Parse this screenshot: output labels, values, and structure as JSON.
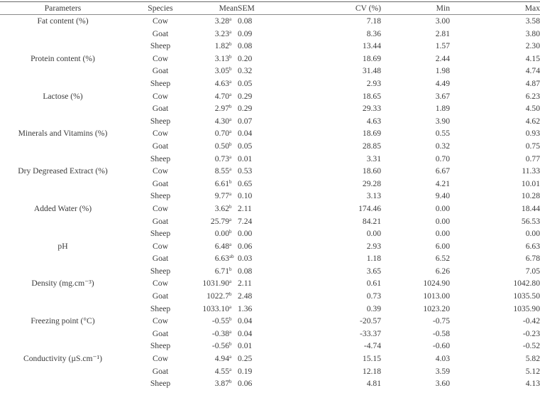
{
  "table": {
    "headers": [
      "Parameters",
      "Species",
      "Mean",
      "SEM",
      "CV (%)",
      "Min",
      "Max"
    ],
    "rows": [
      {
        "parameter": "Fat content (%)",
        "species": "Cow",
        "mean": "3.28",
        "sig": "a",
        "sem": "0.08",
        "cv": "7.18",
        "min": "3.00",
        "max": "3.58"
      },
      {
        "parameter": "",
        "species": "Goat",
        "mean": "3.23",
        "sig": "a",
        "sem": "0.09",
        "cv": "8.36",
        "min": "2.81",
        "max": "3.80"
      },
      {
        "parameter": "",
        "species": "Sheep",
        "mean": "1.82",
        "sig": "b",
        "sem": "0.08",
        "cv": "13.44",
        "min": "1.57",
        "max": "2.30"
      },
      {
        "parameter": "Protein content (%)",
        "species": "Cow",
        "mean": "3.13",
        "sig": "b",
        "sem": "0.20",
        "cv": "18.69",
        "min": "2.44",
        "max": "4.15"
      },
      {
        "parameter": "",
        "species": "Goat",
        "mean": "3.05",
        "sig": "b",
        "sem": "0.32",
        "cv": "31.48",
        "min": "1.98",
        "max": "4.74"
      },
      {
        "parameter": "",
        "species": "Sheep",
        "mean": "4.63",
        "sig": "a",
        "sem": "0.05",
        "cv": "2.93",
        "min": "4.49",
        "max": "4.87"
      },
      {
        "parameter": "Lactose (%)",
        "species": "Cow",
        "mean": "4.70",
        "sig": "a",
        "sem": "0.29",
        "cv": "18.65",
        "min": "3.67",
        "max": "6.23"
      },
      {
        "parameter": "",
        "species": "Goat",
        "mean": "2.97",
        "sig": "b",
        "sem": "0.29",
        "cv": "29.33",
        "min": "1.89",
        "max": "4.50"
      },
      {
        "parameter": "",
        "species": "Sheep",
        "mean": "4.30",
        "sig": "a",
        "sem": "0.07",
        "cv": "4.63",
        "min": "3.90",
        "max": "4.62"
      },
      {
        "parameter": "Minerals and Vitamins (%)",
        "species": "Cow",
        "mean": "0.70",
        "sig": "a",
        "sem": "0.04",
        "cv": "18.69",
        "min": "0.55",
        "max": "0.93"
      },
      {
        "parameter": "",
        "species": "Goat",
        "mean": "0.50",
        "sig": "b",
        "sem": "0.05",
        "cv": "28.85",
        "min": "0.32",
        "max": "0.75"
      },
      {
        "parameter": "",
        "species": "Sheep",
        "mean": "0.73",
        "sig": "a",
        "sem": "0.01",
        "cv": "3.31",
        "min": "0.70",
        "max": "0.77"
      },
      {
        "parameter": "Dry Degreased Extract (%)",
        "species": "Cow",
        "mean": "8.55",
        "sig": "a",
        "sem": "0.53",
        "cv": "18.60",
        "min": "6.67",
        "max": "11.33"
      },
      {
        "parameter": "",
        "species": "Goat",
        "mean": "6.61",
        "sig": "b",
        "sem": "0.65",
        "cv": "29.28",
        "min": "4.21",
        "max": "10.01"
      },
      {
        "parameter": "",
        "species": "Sheep",
        "mean": "9.77",
        "sig": "a",
        "sem": "0.10",
        "cv": "3.13",
        "min": "9.40",
        "max": "10.28"
      },
      {
        "parameter": "Added Water (%)",
        "species": "Cow",
        "mean": "3.62",
        "sig": "b",
        "sem": "2.11",
        "cv": "174.46",
        "min": "0.00",
        "max": "18.44"
      },
      {
        "parameter": "",
        "species": "Goat",
        "mean": "25.79",
        "sig": "a",
        "sem": "7.24",
        "cv": "84.21",
        "min": "0.00",
        "max": "56.53"
      },
      {
        "parameter": "",
        "species": "Sheep",
        "mean": "0.00",
        "sig": "b",
        "sem": "0.00",
        "cv": "0.00",
        "min": "0.00",
        "max": "0.00"
      },
      {
        "parameter": "pH",
        "species": "Cow",
        "mean": "6.48",
        "sig": "a",
        "sem": "0.06",
        "cv": "2.93",
        "min": "6.00",
        "max": "6.63"
      },
      {
        "parameter": "",
        "species": "Goat",
        "mean": "6.63",
        "sig": "ab",
        "sem": "0.03",
        "cv": "1.18",
        "min": "6.52",
        "max": "6.78"
      },
      {
        "parameter": "",
        "species": "Sheep",
        "mean": "6.71",
        "sig": "b",
        "sem": "0.08",
        "cv": "3.65",
        "min": "6.26",
        "max": "7.05"
      },
      {
        "parameter": "Density (mg.cm⁻³)",
        "species": "Cow",
        "mean": "1031.90",
        "sig": "a",
        "sem": "2.11",
        "cv": "0.61",
        "min": "1024.90",
        "max": "1042.80"
      },
      {
        "parameter": "",
        "species": "Goat",
        "mean": "1022.7",
        "sig": "b",
        "sem": "2.48",
        "cv": "0.73",
        "min": "1013.00",
        "max": "1035.50"
      },
      {
        "parameter": "",
        "species": "Sheep",
        "mean": "1033.10",
        "sig": "a",
        "sem": "1.36",
        "cv": "0.39",
        "min": "1023.20",
        "max": "1035.90"
      },
      {
        "parameter": "Freezing point (°C)",
        "species": "Cow",
        "mean": "-0.55",
        "sig": "b",
        "sem": "0.04",
        "cv": "-20.57",
        "min": "-0.75",
        "max": "-0.42"
      },
      {
        "parameter": "",
        "species": "Goat",
        "mean": "-0.38",
        "sig": "a",
        "sem": "0.04",
        "cv": "-33.37",
        "min": "-0.58",
        "max": "-0.23"
      },
      {
        "parameter": "",
        "species": "Sheep",
        "mean": "-0.56",
        "sig": "b",
        "sem": "0.01",
        "cv": "-4.74",
        "min": "-0.60",
        "max": "-0.52"
      },
      {
        "parameter": "Conductivity (µS.cm⁻¹)",
        "species": "Cow",
        "mean": "4.94",
        "sig": "a",
        "sem": "0.25",
        "cv": "15.15",
        "min": "4.03",
        "max": "5.82"
      },
      {
        "parameter": "",
        "species": "Goat",
        "mean": "4.55",
        "sig": "a",
        "sem": "0.19",
        "cv": "12.18",
        "min": "3.59",
        "max": "5.12"
      },
      {
        "parameter": "",
        "species": "Sheep",
        "mean": "3.87",
        "sig": "b",
        "sem": "0.06",
        "cv": "4.81",
        "min": "3.60",
        "max": "4.13"
      }
    ]
  }
}
